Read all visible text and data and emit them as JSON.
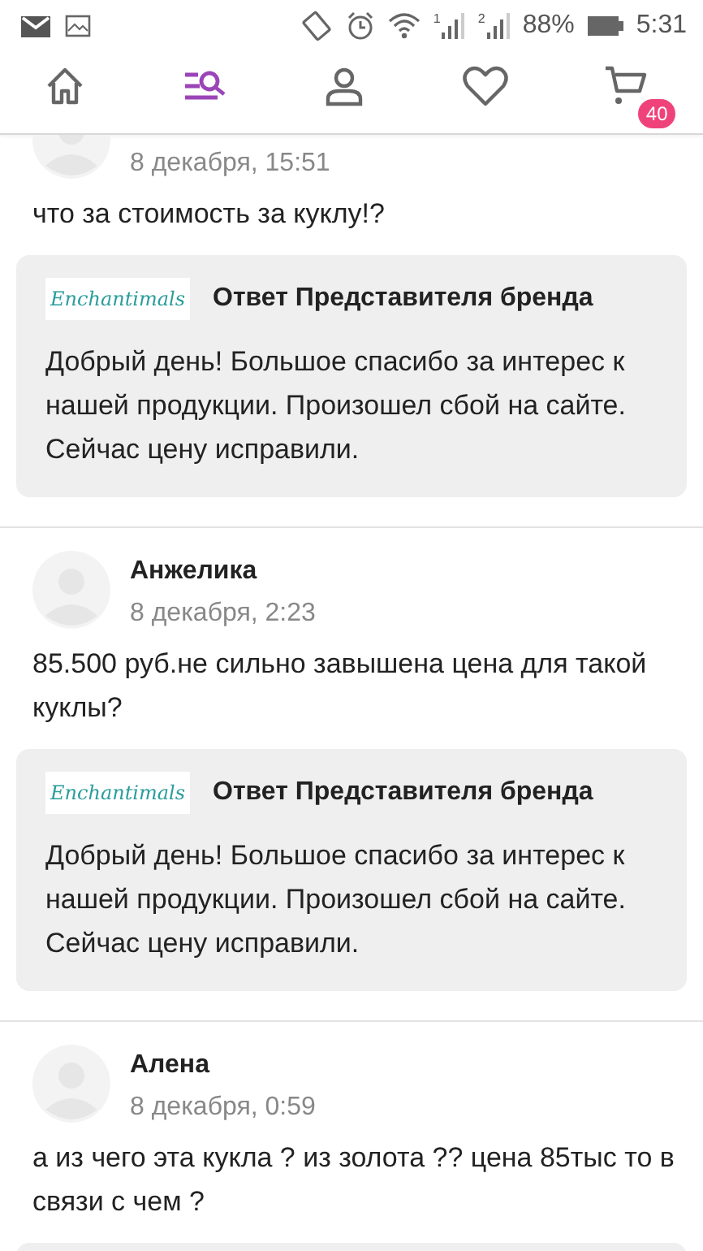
{
  "status_bar": {
    "sims": [
      "1",
      "2"
    ],
    "battery": "88%",
    "time": "5:31"
  },
  "nav": {
    "tabs": [
      {
        "kind": "home",
        "selected": false
      },
      {
        "kind": "catalog",
        "selected": true
      },
      {
        "kind": "profile",
        "selected": false
      },
      {
        "kind": "favorites",
        "selected": false
      },
      {
        "kind": "cart",
        "selected": false,
        "badge": "40"
      }
    ]
  },
  "comments": [
    {
      "date": "8 декабря, 15:51",
      "text": "что за стоимость за куклу!?",
      "reply": {
        "logo": "Enchantimals",
        "title": "Ответ Представителя бренда",
        "text": "Добрый день! Большое спасибо за интерес к нашей продукции. Произошел сбой на сайте. Сейчас цену исправили."
      }
    },
    {
      "author": "Анжелика",
      "date": "8 декабря, 2:23",
      "text": "85.500 руб.не сильно завышена цена для такой куклы?",
      "reply": {
        "logo": "Enchantimals",
        "title": "Ответ Представителя бренда",
        "text": "Добрый день! Большое спасибо за интерес к нашей продукции. Произошел сбой на сайте. Сейчас цену исправили."
      }
    },
    {
      "author": "Алена",
      "date": "8 декабря, 0:59",
      "text": "а из чего эта кукла ? из золота ?? цена 85тыс то в связи с чем ?"
    }
  ]
}
